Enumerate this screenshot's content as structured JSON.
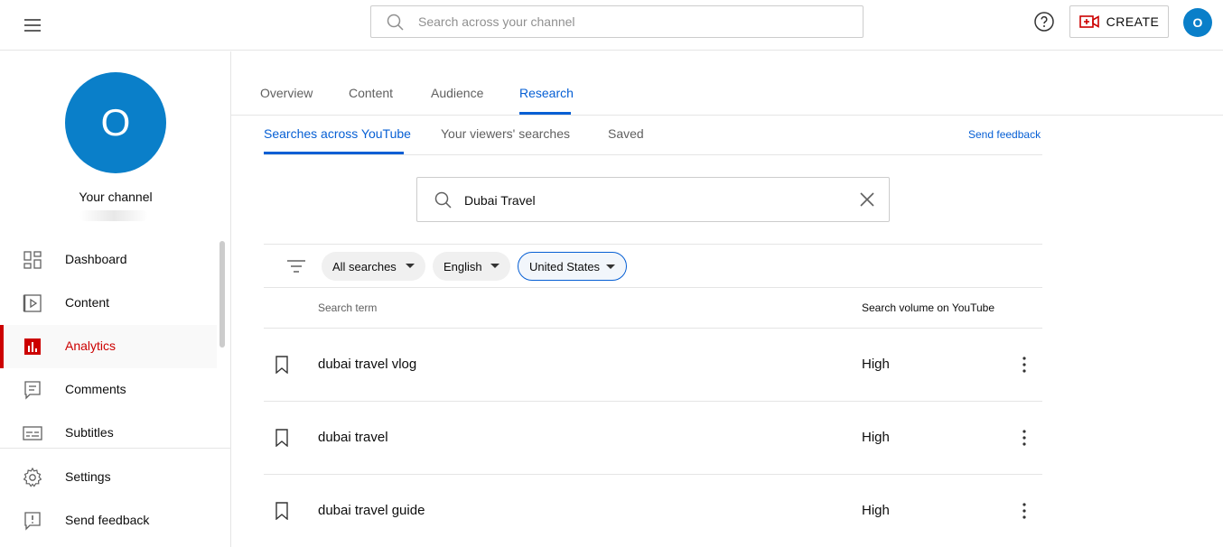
{
  "header": {
    "search_placeholder": "Search across your channel",
    "create_label": "CREATE",
    "avatar_letter": "O"
  },
  "sidebar": {
    "avatar_letter": "O",
    "channel_label": "Your channel",
    "items": [
      {
        "label": "Dashboard",
        "icon": "dashboard-icon"
      },
      {
        "label": "Content",
        "icon": "content-icon"
      },
      {
        "label": "Analytics",
        "icon": "analytics-icon",
        "active": true
      },
      {
        "label": "Comments",
        "icon": "comments-icon"
      },
      {
        "label": "Subtitles",
        "icon": "subtitles-icon"
      }
    ],
    "footer_items": [
      {
        "label": "Settings",
        "icon": "gear-icon"
      },
      {
        "label": "Send feedback",
        "icon": "feedback-icon"
      }
    ]
  },
  "main": {
    "tabs": [
      {
        "label": "Overview"
      },
      {
        "label": "Content"
      },
      {
        "label": "Audience"
      },
      {
        "label": "Research",
        "active": true
      }
    ],
    "sub_tabs": [
      {
        "label": "Searches across YouTube",
        "active": true
      },
      {
        "label": "Your viewers' searches"
      },
      {
        "label": "Saved"
      }
    ],
    "send_feedback": "Send feedback",
    "query": "Dubai Travel",
    "filters": [
      {
        "label": "All searches"
      },
      {
        "label": "English"
      },
      {
        "label": "United States",
        "selected": true
      }
    ],
    "columns": {
      "term": "Search term",
      "volume": "Search volume on YouTube"
    },
    "rows": [
      {
        "term": "dubai travel vlog",
        "volume": "High"
      },
      {
        "term": "dubai travel",
        "volume": "High"
      },
      {
        "term": "dubai travel guide",
        "volume": "High"
      }
    ]
  },
  "colors": {
    "accent_blue": "#065fd4",
    "active_red": "#cc0000",
    "avatar_blue": "#0a7fc9"
  }
}
